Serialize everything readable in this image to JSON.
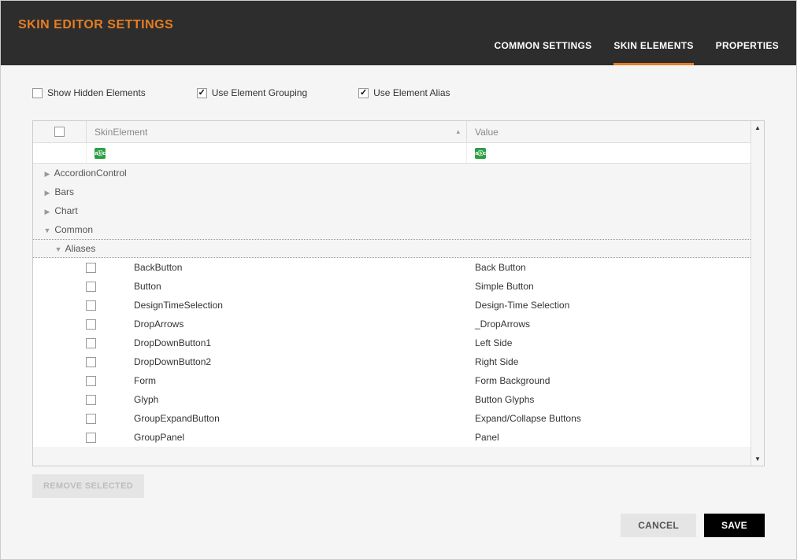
{
  "header": {
    "title": "SKIN EDITOR SETTINGS",
    "tabs": [
      {
        "label": "COMMON SETTINGS",
        "active": false
      },
      {
        "label": "SKIN ELEMENTS",
        "active": true
      },
      {
        "label": "PROPERTIES",
        "active": false
      }
    ]
  },
  "options": {
    "show_hidden": {
      "label": "Show Hidden Elements",
      "checked": false
    },
    "grouping": {
      "label": "Use Element Grouping",
      "checked": true
    },
    "alias": {
      "label": "Use Element Alias",
      "checked": true
    }
  },
  "grid": {
    "columns": {
      "skin": "SkinElement",
      "value": "Value"
    },
    "groups": [
      {
        "name": "AccordionControl",
        "expanded": false
      },
      {
        "name": "Bars",
        "expanded": false
      },
      {
        "name": "Chart",
        "expanded": false
      },
      {
        "name": "Common",
        "expanded": true
      }
    ],
    "subgroup": "Aliases",
    "rows": [
      {
        "name": "BackButton",
        "value": "Back Button"
      },
      {
        "name": "Button",
        "value": "Simple Button"
      },
      {
        "name": "DesignTimeSelection",
        "value": "Design-Time Selection"
      },
      {
        "name": "DropArrows",
        "value": "_DropArrows"
      },
      {
        "name": "DropDownButton1",
        "value": "Left Side"
      },
      {
        "name": "DropDownButton2",
        "value": "Right Side"
      },
      {
        "name": "Form",
        "value": "Form Background"
      },
      {
        "name": "Glyph",
        "value": "Button Glyphs"
      },
      {
        "name": "GroupExpandButton",
        "value": "Expand/Collapse Buttons"
      },
      {
        "name": "GroupPanel",
        "value": "Panel"
      }
    ]
  },
  "buttons": {
    "remove": "REMOVE SELECTED",
    "cancel": "CANCEL",
    "save": "SAVE"
  }
}
